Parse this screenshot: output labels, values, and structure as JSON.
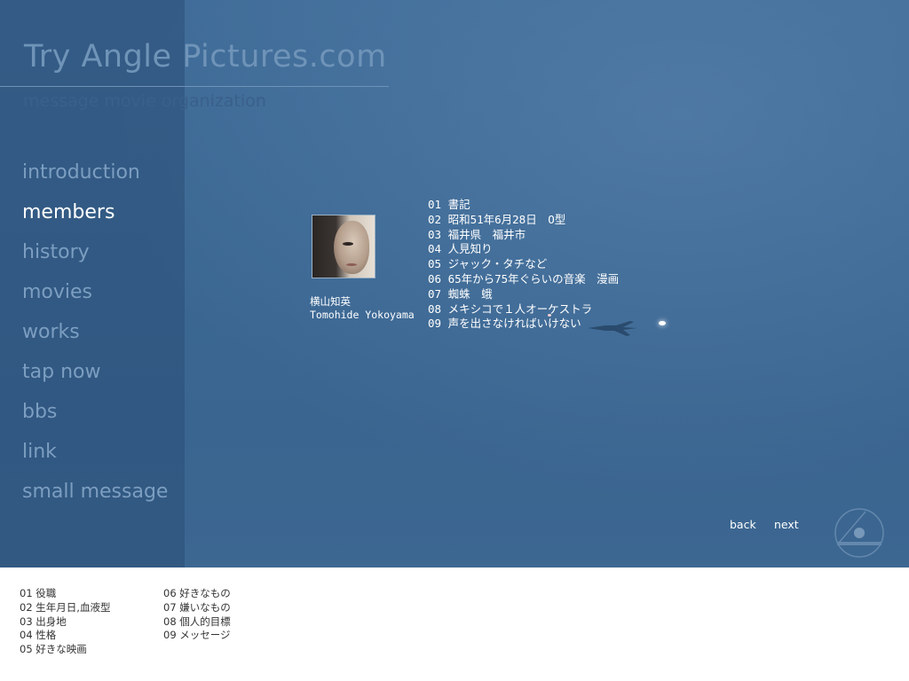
{
  "site": {
    "title": "Try Angle Pictures.com",
    "subtitle": "message movie organization"
  },
  "nav": [
    {
      "label": "introduction",
      "active": false
    },
    {
      "label": "members",
      "active": true
    },
    {
      "label": "history",
      "active": false
    },
    {
      "label": "movies",
      "active": false
    },
    {
      "label": "works",
      "active": false
    },
    {
      "label": "tap now",
      "active": false
    },
    {
      "label": "bbs",
      "active": false
    },
    {
      "label": "link",
      "active": false
    },
    {
      "label": "small message",
      "active": false
    }
  ],
  "profile": {
    "name_jp": "横山知英",
    "name_en": "Tomohide Yokoyama",
    "answers": [
      "01 書記",
      "02 昭和51年6月28日　O型",
      "03 福井県　福井市",
      "04 人見知り",
      "05 ジャック・タチなど",
      "06 65年から75年ぐらいの音楽　漫画",
      "07 蜘蛛　蛾",
      "08 メキシコで１人オーケストラ",
      "09 声を出さなければいけない"
    ]
  },
  "pager": {
    "back": "back",
    "next": "next"
  },
  "legend": {
    "col1": [
      "01 役職",
      "02 生年月日,血液型",
      "03 出身地",
      "04 性格",
      "05 好きな映画"
    ],
    "col2": [
      "06 好きなもの",
      "07 嫌いなもの",
      "08 個人的目標",
      "09 メッセージ"
    ]
  },
  "colors": {
    "background": "#3b6793",
    "nav_inactive": "#7c9ec1",
    "nav_active": "#ffffff"
  },
  "icons": {
    "emblem": "triangle-circle-logo-icon"
  }
}
